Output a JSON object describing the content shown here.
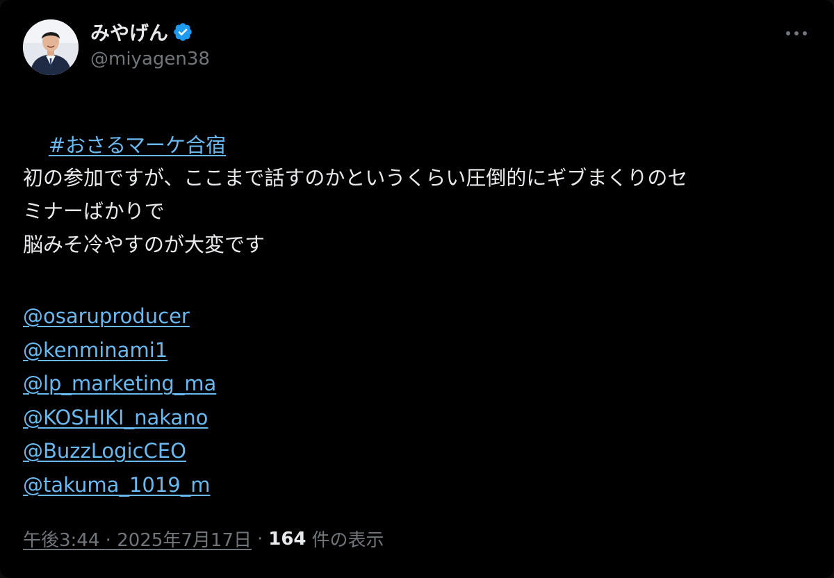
{
  "author": {
    "name": "みやげん",
    "handle": "@miyagen38",
    "verified": true
  },
  "hashtag": "#おさるマーケ合宿",
  "body_lines": [
    "初の参加ですが、ここまで話すのかというくらい圧倒的にギブまくりのセ",
    "ミナーばかりで",
    "脳みそ冷やすのが大変です"
  ],
  "mentions": [
    "@osaruproducer",
    "@kenminami1",
    "@lp_marketing_ma",
    "@KOSHIKI_nakano",
    "@BuzzLogicCEO",
    "@takuma_1019_m"
  ],
  "meta": {
    "time": "午後3:44",
    "separator": "·",
    "date": "2025年7月17日",
    "views": "164",
    "views_label": "件の表示"
  },
  "colors": {
    "background": "#000000",
    "text": "#e7e9ea",
    "muted": "#71767b",
    "link": "#6ab8f0",
    "verified": "#1d9bf0"
  }
}
